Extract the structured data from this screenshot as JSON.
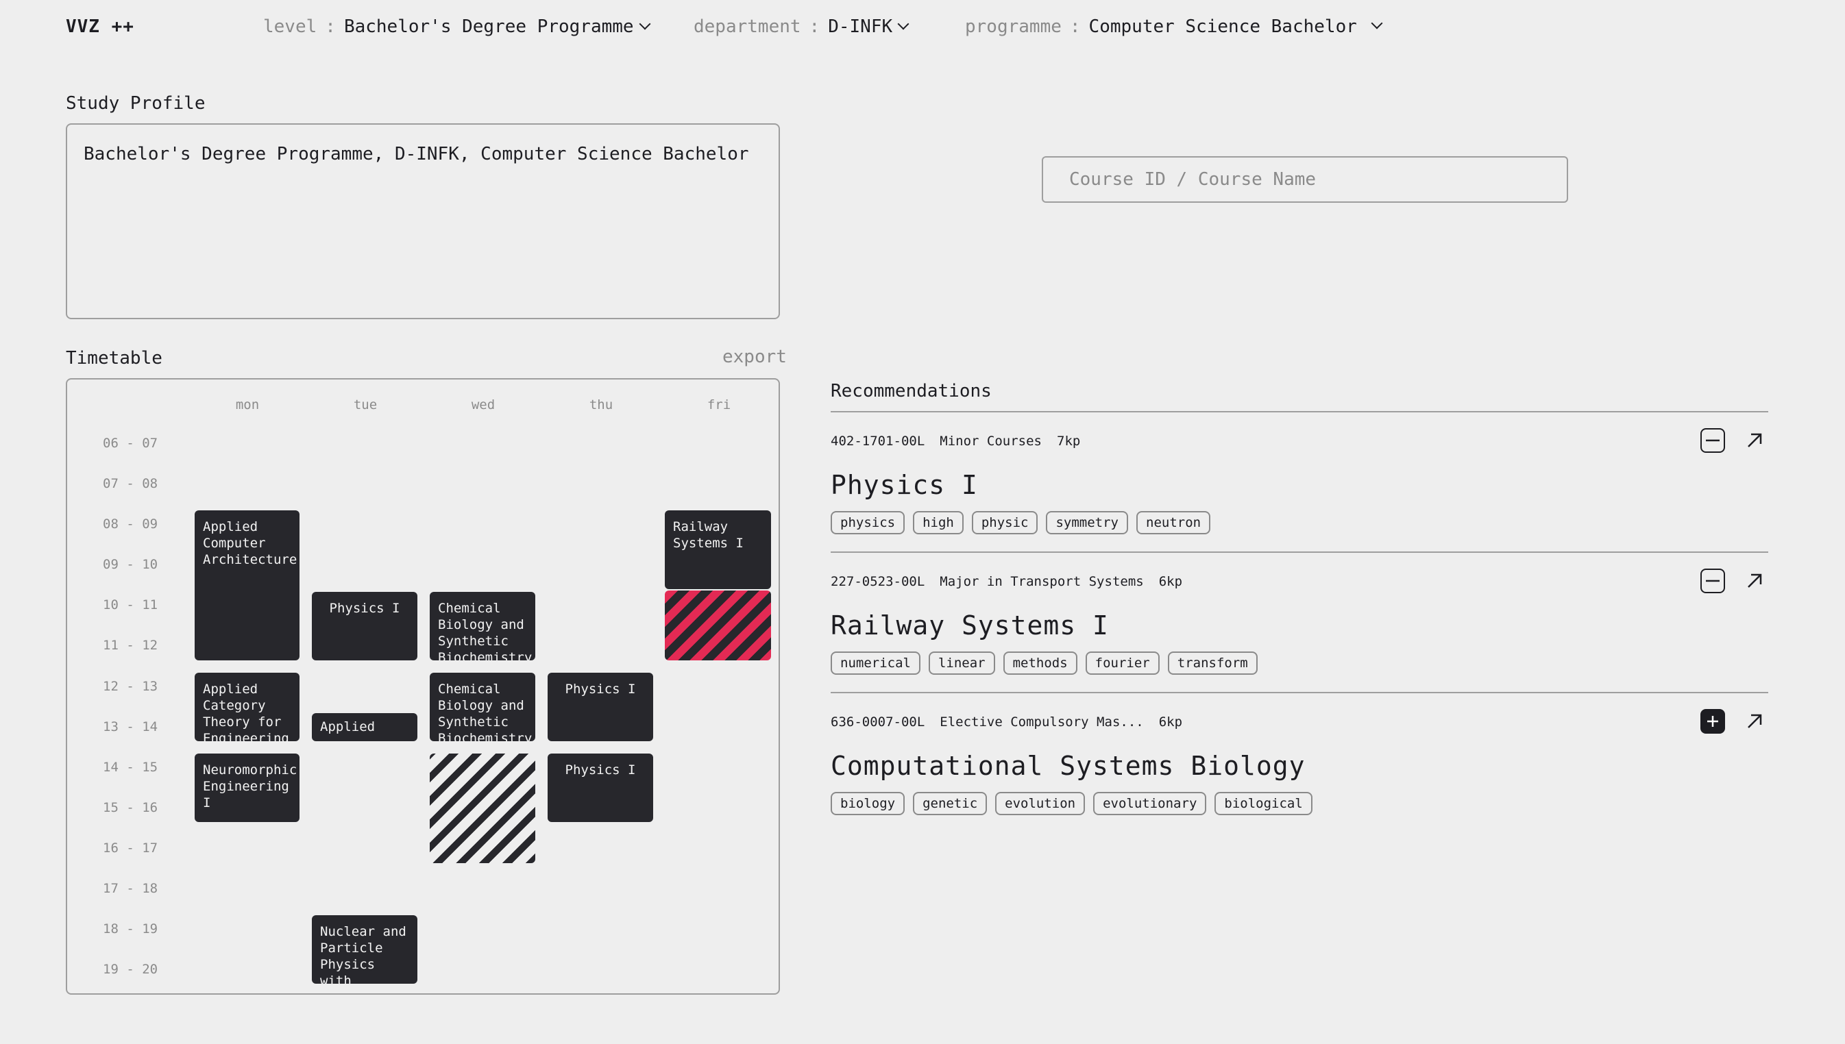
{
  "header": {
    "logo": "VVZ ++",
    "level_key": "level",
    "level_value": "Bachelor's Degree Programme",
    "department_key": "department",
    "department_value": "D-INFK",
    "programme_key": "programme",
    "programme_value": "Computer Science Bachelor",
    "separator": ":"
  },
  "profile": {
    "heading": "Study Profile",
    "text": "Bachelor's Degree Programme, D-INFK, Computer Science Bachelor"
  },
  "search": {
    "placeholder": "Course ID / Course Name"
  },
  "timetable": {
    "heading": "Timetable",
    "export_label": "export",
    "days": [
      "mon",
      "tue",
      "wed",
      "thu",
      "fri"
    ],
    "slots": [
      "06 - 07",
      "07 - 08",
      "08 - 09",
      "09 - 10",
      "10 - 11",
      "11 - 12",
      "12 - 13",
      "13 - 14",
      "14 - 15",
      "15 - 16",
      "16 - 17",
      "17 - 18",
      "18 - 19",
      "19 - 20"
    ],
    "events": [
      {
        "title": "Applied Computer Architecture"
      },
      {
        "title": "Railway Systems I"
      },
      {
        "title": "Physics I"
      },
      {
        "title": "Chemical Biology and Synthetic Biochemistry"
      },
      {
        "title": "Applied Category Theory for Engineering"
      },
      {
        "title": "Chemical Biology and Synthetic Biochemistry"
      },
      {
        "title": "Physics I"
      },
      {
        "title": "Applied"
      },
      {
        "title": "Neuromorphic Engineering I"
      },
      {
        "title": "Physics I"
      },
      {
        "title": "Nuclear and Particle Physics with Applications"
      }
    ]
  },
  "recommendations": {
    "heading": "Recommendations",
    "items": [
      {
        "id": "402-1701-00L",
        "category": "Minor Courses",
        "credits": "7kp",
        "name": "Physics I",
        "tags": [
          "physics",
          "high",
          "physic",
          "symmetry",
          "neutron"
        ],
        "action": "remove"
      },
      {
        "id": "227-0523-00L",
        "category": "Major in Transport Systems",
        "credits": "6kp",
        "name": "Railway Systems I",
        "tags": [
          "numerical",
          "linear",
          "methods",
          "fourier",
          "transform"
        ],
        "action": "remove"
      },
      {
        "id": "636-0007-00L",
        "category": "Elective Compulsory Mas...",
        "credits": "6kp",
        "name": "Computational Systems Biology",
        "tags": [
          "biology",
          "genetic",
          "evolution",
          "evolutionary",
          "biological"
        ],
        "action": "add"
      }
    ]
  },
  "colors": {
    "background": "#eeeeee",
    "event": "#27272c",
    "conflict": "#e32a54",
    "muted": "#8a8a8a"
  }
}
